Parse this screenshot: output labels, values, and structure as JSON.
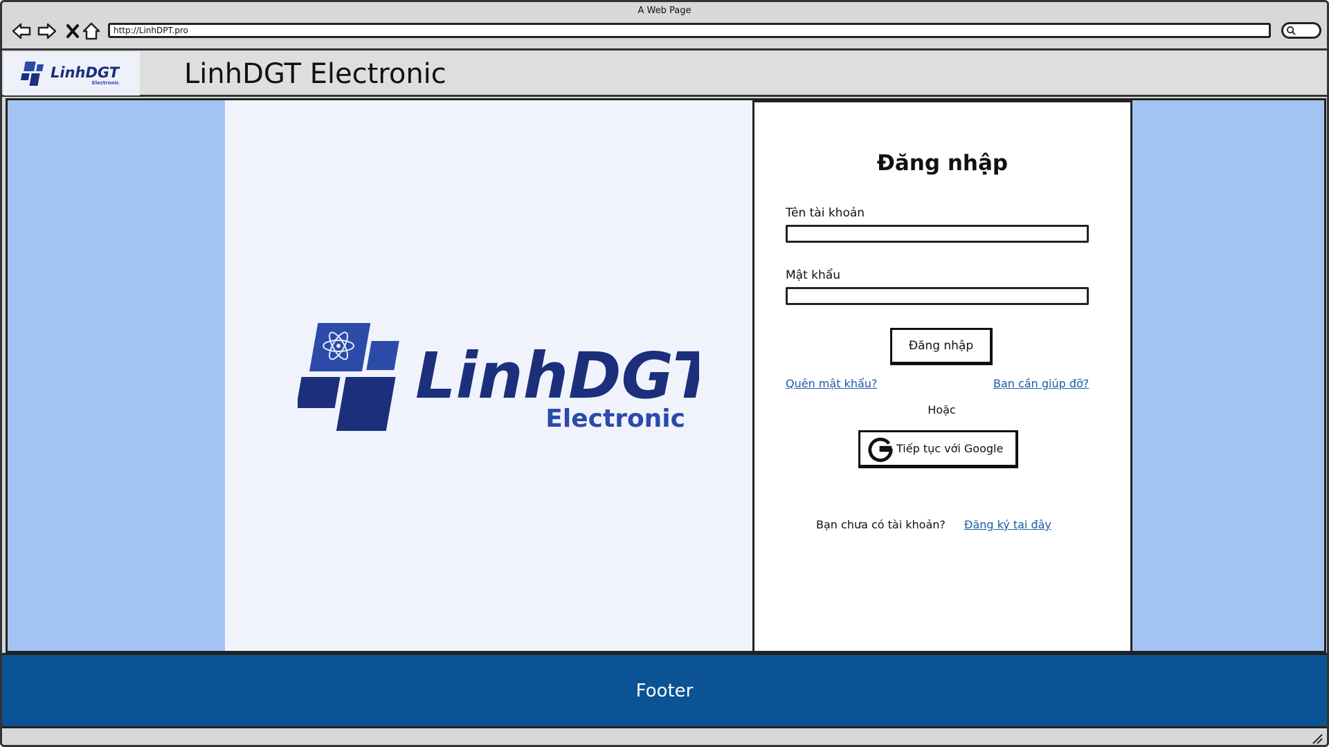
{
  "browser": {
    "window_title": "A Web Page",
    "url": "http://LinhDPT.pro"
  },
  "header": {
    "logo_text": "LinhDGT",
    "logo_subtext": "Electronic",
    "title": "LinhDGT Electronic"
  },
  "hero": {
    "logo_text": "LinhDGT",
    "logo_subtext": "Electronic"
  },
  "login": {
    "title": "Đăng nhập",
    "username_label": "Tên tài khoản",
    "username_value": "",
    "password_label": "Mật khẩu",
    "password_value": "",
    "submit_label": "Đăng nhập",
    "forgot_link": "Quên mật khẩu?",
    "help_link": "Bạn cần giúp đỡ?",
    "or_text": "Hoặc",
    "google_label": "Tiếp tục với Google",
    "no_account_text": "Bạn chưa có tài khoản?",
    "signup_link": "Đăng ký tại đây"
  },
  "footer": {
    "text": "Footer"
  },
  "colors": {
    "side_panel": "#a3c4f3",
    "hero_bg": "#f0f3fc",
    "brand_navy": "#1b2f7a",
    "brand_blue": "#2c4aa8",
    "footer_bg": "#0b5394",
    "link": "#1f5aa6"
  }
}
